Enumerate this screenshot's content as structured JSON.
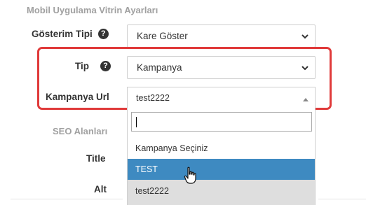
{
  "section_title": "Mobil Uygulama Vitrin Ayarları",
  "display_type": {
    "label": "Gösterim Tipi",
    "help_icon": "question-circle-icon",
    "value": "Kare Göster"
  },
  "type": {
    "label": "Tip",
    "help_icon": "question-circle-icon",
    "value": "Kampanya"
  },
  "campaign_url": {
    "label": "Kampanya Url",
    "value": "test2222",
    "search_value": "",
    "options": [
      "Kampanya Seçiniz",
      "TEST",
      "test2222"
    ],
    "hovered_option": "TEST",
    "selected_option": "test2222"
  },
  "seo": {
    "title": "SEO Alanları",
    "title_label": "Title",
    "alt_label": "Alt"
  },
  "colors": {
    "highlight_border": "#e03a3a",
    "hover_option_bg": "#3e8ac1",
    "selected_option_bg": "#dedede"
  }
}
